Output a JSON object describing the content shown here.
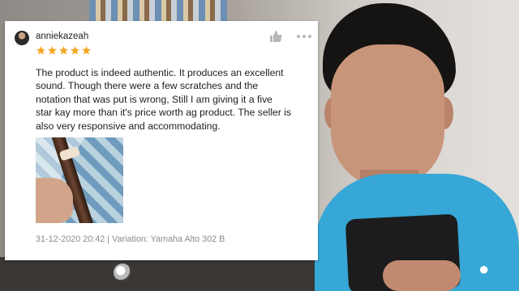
{
  "review": {
    "username": "anniekazeah",
    "rating": 5,
    "text": "The product is indeed authentic. It produces an excellent\nsound. Though there were a few scratches and the\nnotation that was put is wrong, Still  I am giving it a five\nstar kay more than it's price worth ag product. The seller is\nalso very responsive and accommodating.",
    "meta": "31-12-2020 20:42 | Variation: Yamaha Alto 302 B"
  },
  "colors": {
    "star": "#f5a623",
    "icon_gray": "#b8b8b8",
    "shirt": "#36a7d6"
  },
  "icons": {
    "like": "thumbs-up-icon",
    "more": "more-options-icon",
    "star": "star-icon"
  }
}
